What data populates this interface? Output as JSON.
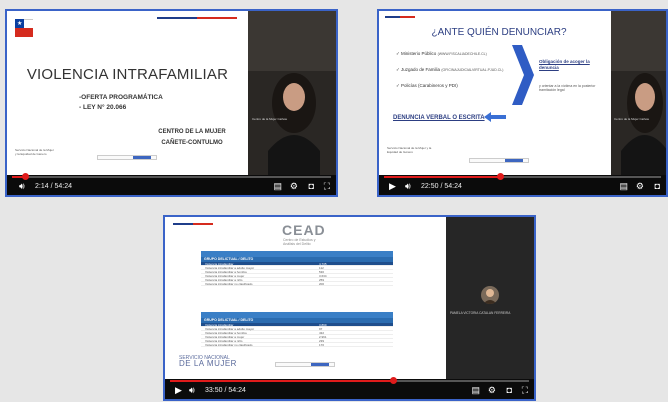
{
  "players": [
    {
      "slide": {
        "title": "VIOLENCIA INTRAFAMILIAR",
        "bullets": [
          "-OFERTA PROGRAMÁTICA",
          "- LEY N° 20.066"
        ],
        "org_line1": "CENTRO DE LA MUJER",
        "org_line2": "CAÑETE-CONTULMO",
        "logo_text": "Servicio Nacional de la Mujer y la Equidad de Género"
      },
      "camera_caption": "Centro de la Mujer Cañete",
      "time": "2:14 / 54:24",
      "progress": 0.041
    },
    {
      "slide": {
        "title": "¿ANTE QUIÉN DENUNCIAR?",
        "items": [
          {
            "label": "Ministerio Público",
            "note": "(WWW.FISCALIADECHILE.CL)"
          },
          {
            "label": "Juzgado de Familia",
            "note": "(OFICINAJUDICIALVIRTUAL.PJUD.CL)"
          },
          {
            "label": "Policías (Carabineros y PDI)",
            "note": ""
          }
        ],
        "obligation_title": "Obligación de acoger la denuncia",
        "obligation_text": "y orientar a la víctima en la posterior tramitación legal",
        "report_label": "DENUNCIA VERBAL O ESCRITA",
        "logo_text": "Servicio Nacional de la Mujer y la Equidad de Género"
      },
      "camera_caption": "Centro de la Mujer Cañete",
      "time": "22:50 / 54:24",
      "progress": 0.42
    },
    {
      "slide": {
        "title": "CEAD",
        "subtitle": "Centro de Estudios y Análisis del Delito",
        "table1_header": "GRUPO DELICTUAL / DELITO",
        "table1_rows": [
          {
            "label": "Violencia intrafamiliar",
            "value": "4.735"
          },
          {
            "label": "Violencia intrafamiliar a adulto mayor",
            "value": "112"
          },
          {
            "label": "Violencia intrafamiliar a hombre",
            "value": "530"
          },
          {
            "label": "Violencia intrafamiliar a mujer",
            "value": "3.634"
          },
          {
            "label": "Violencia intrafamiliar a niño",
            "value": "259"
          },
          {
            "label": "Violencia intrafamiliar no clasificado",
            "value": "200"
          }
        ],
        "table2_header": "GRUPO DELICTUAL / DELITO",
        "table2_rows": [
          {
            "label": "Violencia intrafamiliar",
            "value": "3.899"
          },
          {
            "label": "Violencia intrafamiliar a adulto mayor",
            "value": "97"
          },
          {
            "label": "Violencia intrafamiliar a hombre",
            "value": "432"
          },
          {
            "label": "Violencia intrafamiliar a mujer",
            "value": "2.961"
          },
          {
            "label": "Violencia intrafamiliar a niño",
            "value": "239"
          },
          {
            "label": "Violencia intrafamiliar no clasificado",
            "value": "170"
          }
        ],
        "logo_line1": "SERVICIO NACIONAL",
        "logo_line2": "DE LA MUJER"
      },
      "camera_caption": "PAMELA VICTORIA CATALAN FERREIRA",
      "time": "33:50 / 54:24",
      "progress": 0.62
    }
  ]
}
